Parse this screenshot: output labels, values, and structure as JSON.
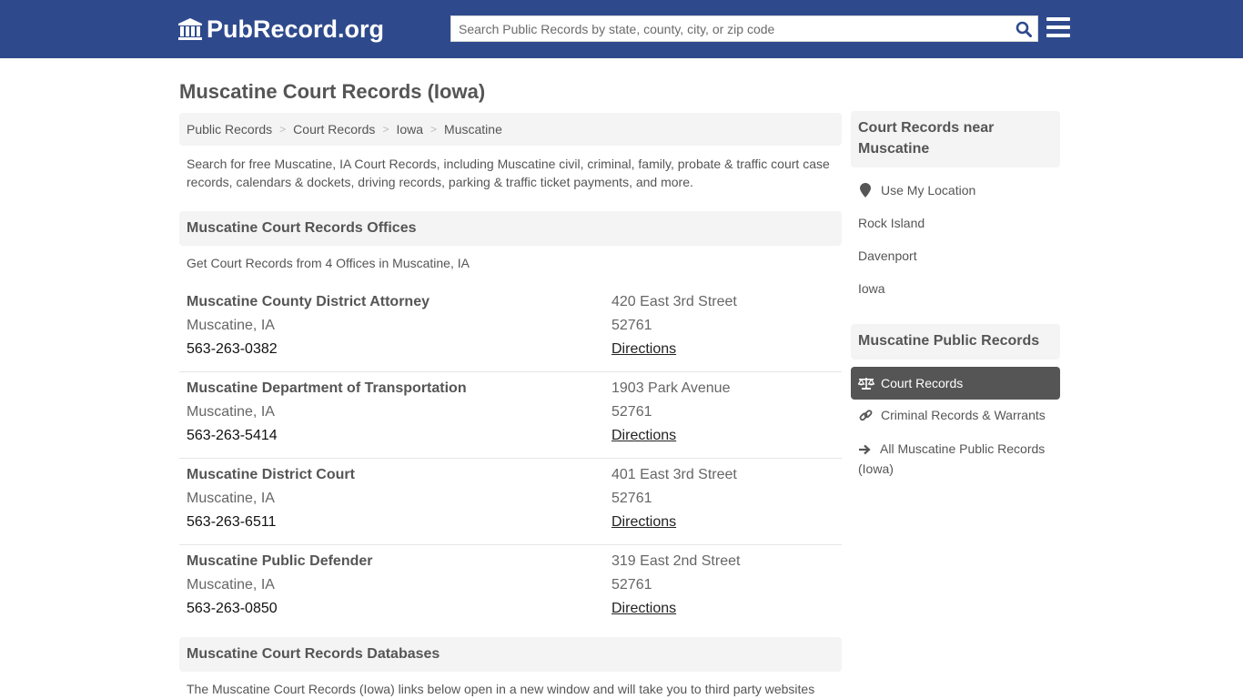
{
  "header": {
    "logo_text": "PubRecord.org",
    "search_placeholder": "Search Public Records by state, county, city, or zip code",
    "brand_color": "#2e4a8c",
    "icons": {
      "logo": "bank-building-icon",
      "search": "search-icon",
      "menu": "hamburger-menu-icon"
    }
  },
  "page": {
    "title": "Muscatine Court Records (Iowa)"
  },
  "breadcrumb": [
    {
      "label": "Public Records"
    },
    {
      "label": "Court Records"
    },
    {
      "label": "Iowa"
    },
    {
      "label": "Muscatine"
    }
  ],
  "breadcrumb_separator": ">",
  "intro": "Search for free Muscatine, IA Court Records, including Muscatine civil, criminal, family, probate & traffic court case records, calendars & dockets, driving records, parking & traffic ticket payments, and more.",
  "offices_section": {
    "title": "Muscatine Court Records Offices",
    "subtitle": "Get Court Records from 4 Offices in Muscatine, IA",
    "offices": [
      {
        "name": "Muscatine County District Attorney",
        "city": "Muscatine, IA",
        "phone": "563-263-0382",
        "address": "420 East 3rd Street",
        "zip": "52761",
        "directions": "Directions"
      },
      {
        "name": "Muscatine Department of Transportation",
        "city": "Muscatine, IA",
        "phone": "563-263-5414",
        "address": "1903 Park Avenue",
        "zip": "52761",
        "directions": "Directions"
      },
      {
        "name": "Muscatine District Court",
        "city": "Muscatine, IA",
        "phone": "563-263-6511",
        "address": "401 East 3rd Street",
        "zip": "52761",
        "directions": "Directions"
      },
      {
        "name": "Muscatine Public Defender",
        "city": "Muscatine, IA",
        "phone": "563-263-0850",
        "address": "319 East 2nd Street",
        "zip": "52761",
        "directions": "Directions"
      }
    ]
  },
  "databases_section": {
    "title": "Muscatine Court Records Databases",
    "text": "The Muscatine Court Records (Iowa) links below open in a new window and will take you to third party websites"
  },
  "sidebar": {
    "nearby": {
      "title": "Court Records near Muscatine",
      "use_location": "Use My Location",
      "links": [
        "Rock Island",
        "Davenport",
        "Iowa"
      ]
    },
    "public_records": {
      "title": "Muscatine Public Records",
      "items": [
        {
          "label": "Court Records",
          "icon": "scales-icon",
          "active": true
        },
        {
          "label": "Criminal Records & Warrants",
          "icon": "link-icon",
          "active": false
        },
        {
          "label": "All Muscatine Public Records (Iowa)",
          "icon": "arrow-right-icon",
          "active": false
        }
      ]
    }
  }
}
